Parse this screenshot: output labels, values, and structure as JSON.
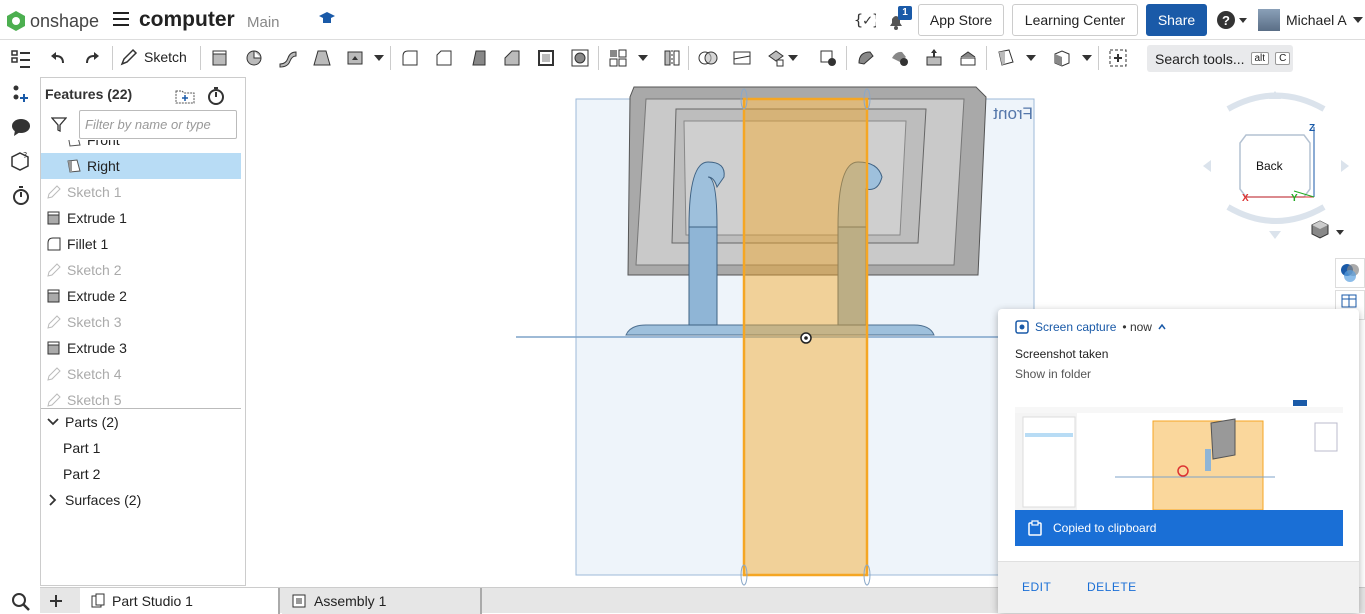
{
  "app": {
    "logo_text": "onshape",
    "doc_title": "computer",
    "branch": "Main"
  },
  "header": {
    "notifications_count": "1",
    "app_store_label": "App Store",
    "learning_center_label": "Learning Center",
    "share_label": "Share",
    "user_name": "Michael A"
  },
  "toolbar": {
    "sketch_label": "Sketch",
    "search_label": "Search tools...",
    "search_shortcut_1": "alt",
    "search_shortcut_2": "C"
  },
  "feature_panel": {
    "title": "Features (22)",
    "filter_placeholder": "Filter by name or type",
    "features": [
      {
        "label": "Front",
        "state": "normal"
      },
      {
        "label": "Right",
        "state": "selected"
      },
      {
        "label": "Sketch 1",
        "state": "dim"
      },
      {
        "label": "Extrude 1",
        "state": "normal"
      },
      {
        "label": "Fillet 1",
        "state": "normal"
      },
      {
        "label": "Sketch 2",
        "state": "dim"
      },
      {
        "label": "Extrude 2",
        "state": "normal"
      },
      {
        "label": "Sketch 3",
        "state": "dim"
      },
      {
        "label": "Extrude 3",
        "state": "normal"
      },
      {
        "label": "Sketch 4",
        "state": "dim"
      },
      {
        "label": "Sketch 5",
        "state": "dim"
      }
    ],
    "parts_label": "Parts (2)",
    "parts": [
      "Part 1",
      "Part 2"
    ],
    "surfaces_label": "Surfaces (2)"
  },
  "viewport": {
    "plane_label": "Front",
    "view_cube_label": "Back",
    "axis_z": "Z",
    "axis_x": "X",
    "axis_y": "Y"
  },
  "tabs": [
    {
      "label": "Part Studio 1"
    },
    {
      "label": "Assembly 1"
    }
  ],
  "toast": {
    "source": "Screen capture",
    "time": "now",
    "title": "Screenshot taken",
    "subtitle": "Show in folder",
    "copied_label": "Copied to clipboard",
    "edit_label": "EDIT",
    "delete_label": "DELETE"
  },
  "colors": {
    "accent": "#1a5aa8",
    "selection": "#b8dcf5",
    "highlight_orange": "#f5a623"
  }
}
